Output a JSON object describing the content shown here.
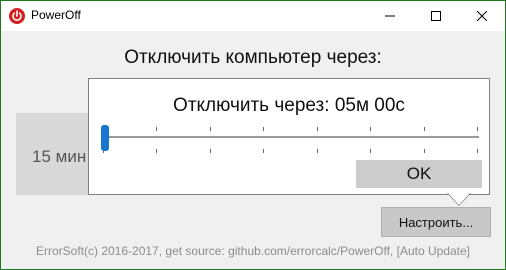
{
  "window": {
    "title": "PowerOff",
    "app_icon": "power-icon",
    "accent_color": "#d32020"
  },
  "titlebar_buttons": {
    "minimize_icon": "minimize-icon",
    "maximize_icon": "maximize-icon",
    "close_icon": "close-icon"
  },
  "main": {
    "label": "Отключить компьютер через:",
    "time_button_label": "15 мин"
  },
  "popup": {
    "title": "Отключить через: 05м 00с",
    "slider": {
      "value": 0,
      "thumb_color": "#1874d0"
    },
    "ok_label": "OK"
  },
  "configure_button": {
    "label": "Настроить..."
  },
  "footer": {
    "text": "ErrorSoft(c) 2016-2017, get source: github.com/errorcalc/PowerOff, [Auto Update]"
  }
}
